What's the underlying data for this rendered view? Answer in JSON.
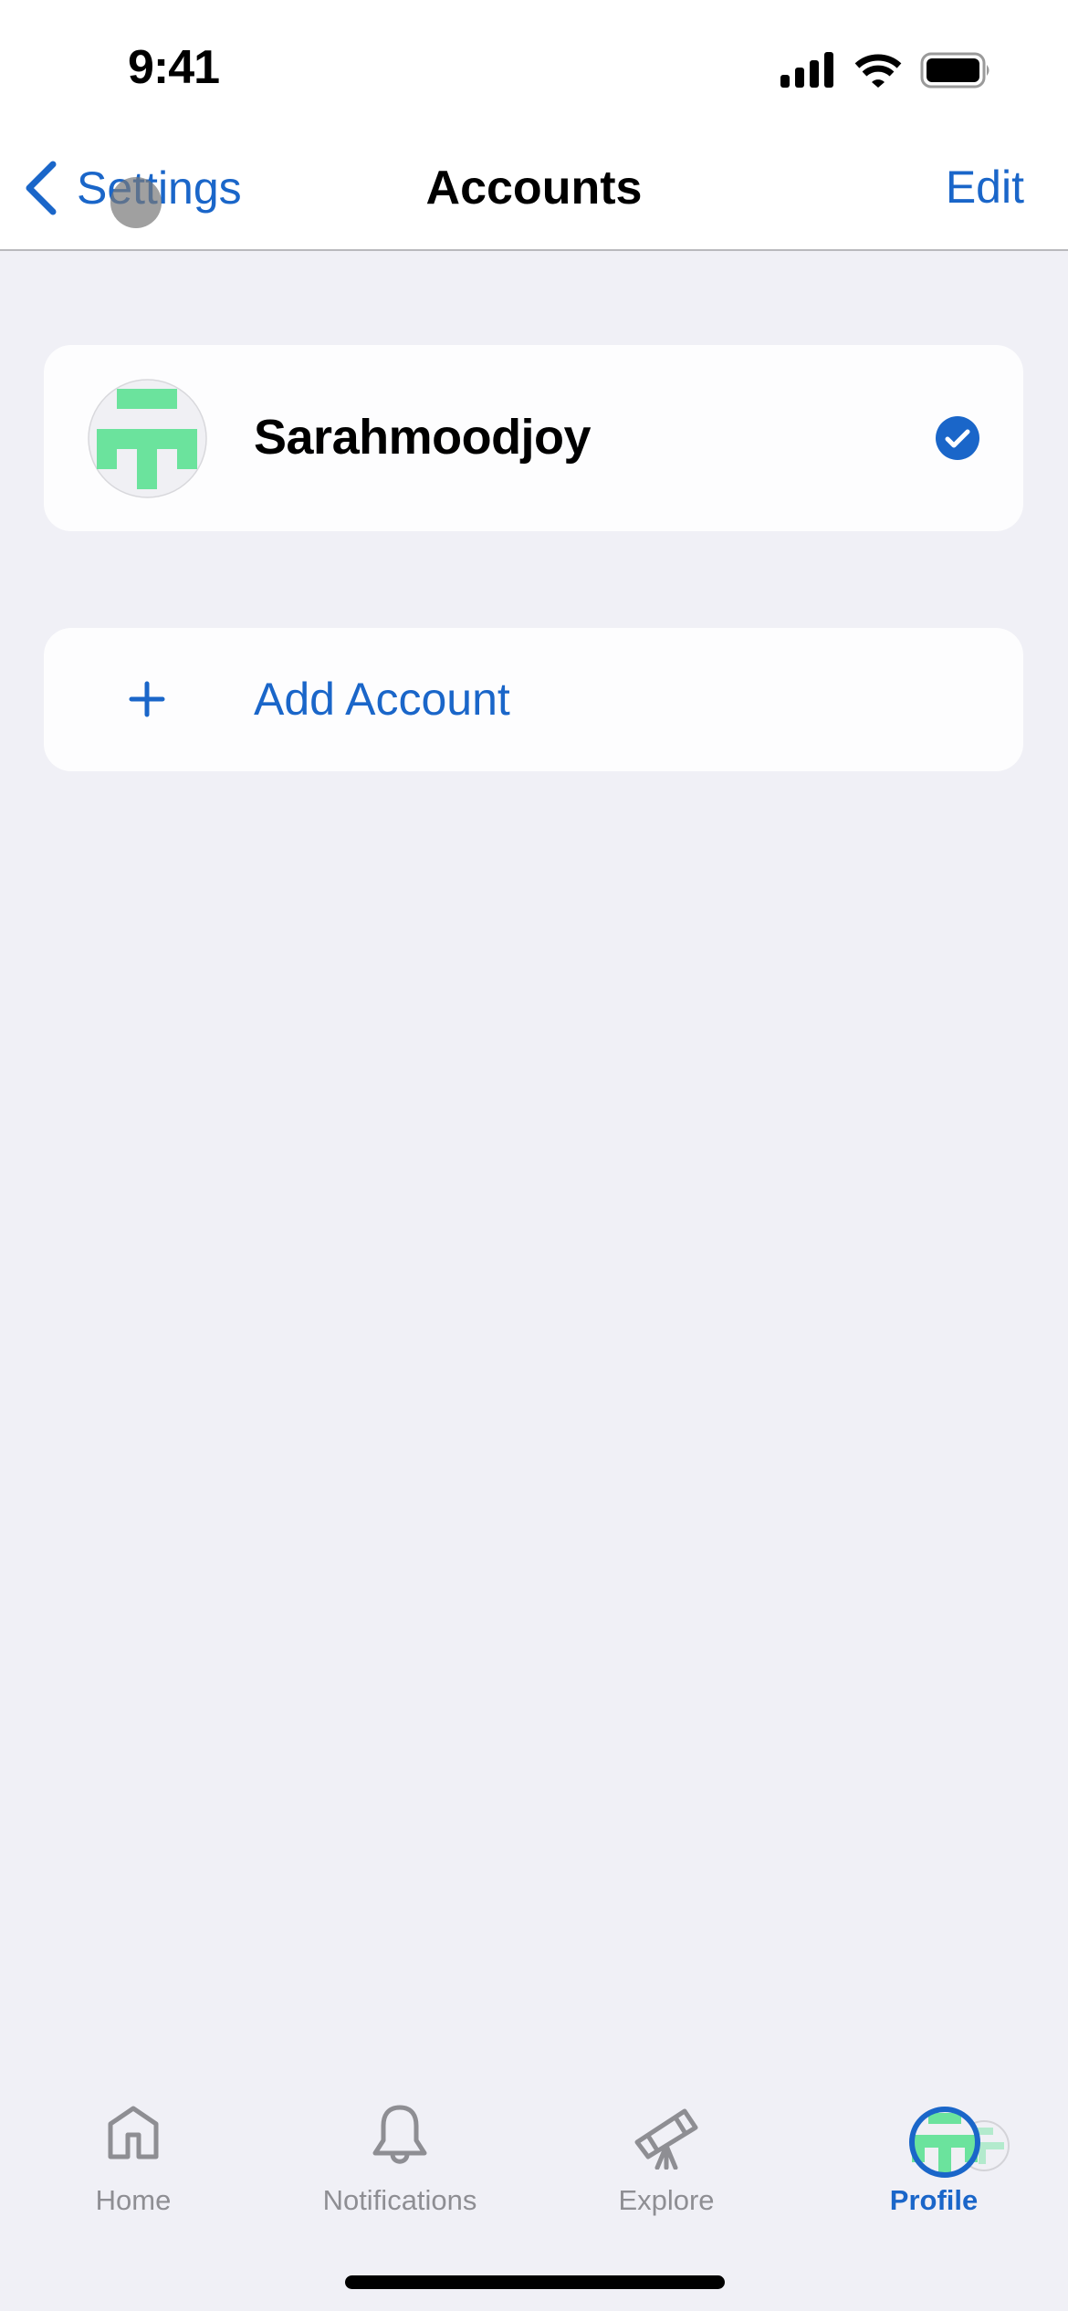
{
  "status_bar": {
    "time": "9:41",
    "icons": [
      "cellular-signal-icon",
      "wifi-icon",
      "battery-icon"
    ]
  },
  "nav_bar": {
    "back_label": "Settings",
    "back_icon": "chevron-left-icon",
    "title": "Accounts",
    "edit_label": "Edit"
  },
  "accounts": [
    {
      "username": "Sarahmoodjoy",
      "selected": true,
      "avatar_icon": "identicon-avatar",
      "status_icon": "checkmark-circle-icon"
    }
  ],
  "add_account": {
    "label": "Add Account",
    "icon": "plus-icon"
  },
  "tab_bar": {
    "items": [
      {
        "label": "Home",
        "icon": "house-icon",
        "active": false
      },
      {
        "label": "Notifications",
        "icon": "bell-icon",
        "active": false
      },
      {
        "label": "Explore",
        "icon": "telescope-icon",
        "active": false
      },
      {
        "label": "Profile",
        "icon": "profile-avatar-icon",
        "active": true
      }
    ]
  },
  "colors": {
    "accent": "#1a66c9",
    "background": "#f0f0f6",
    "card": "#fdfdfe",
    "inactive_tab": "#8e8e93",
    "avatar_green": "#6be39d",
    "avatar_bg": "#f0f0f4"
  }
}
